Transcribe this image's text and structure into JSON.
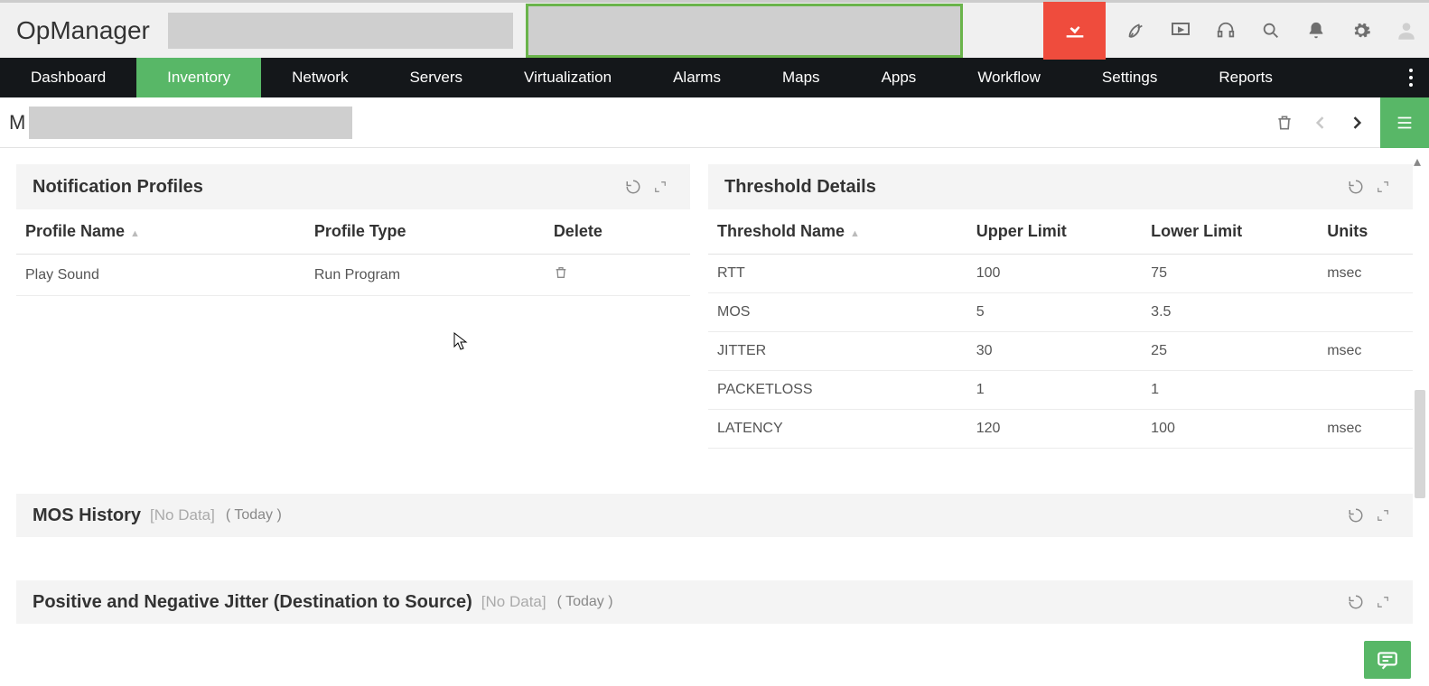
{
  "app_name": "OpManager",
  "nav": {
    "items": [
      "Dashboard",
      "Inventory",
      "Network",
      "Servers",
      "Virtualization",
      "Alarms",
      "Maps",
      "Apps",
      "Workflow",
      "Settings",
      "Reports"
    ],
    "active_index": 1
  },
  "sub_header": {
    "crumb_prefix": "M"
  },
  "notification_profiles": {
    "title": "Notification Profiles",
    "columns": [
      "Profile Name",
      "Profile Type",
      "Delete"
    ],
    "rows": [
      {
        "name": "Play Sound",
        "type": "Run Program"
      }
    ]
  },
  "threshold_details": {
    "title": "Threshold Details",
    "columns": [
      "Threshold Name",
      "Upper Limit",
      "Lower Limit",
      "Units"
    ],
    "rows": [
      {
        "name": "RTT",
        "upper": "100",
        "lower": "75",
        "units": "msec"
      },
      {
        "name": "MOS",
        "upper": "5",
        "lower": "3.5",
        "units": ""
      },
      {
        "name": "JITTER",
        "upper": "30",
        "lower": "25",
        "units": "msec"
      },
      {
        "name": "PACKETLOSS",
        "upper": "1",
        "lower": "1",
        "units": ""
      },
      {
        "name": "LATENCY",
        "upper": "120",
        "lower": "100",
        "units": "msec"
      }
    ]
  },
  "mos_history": {
    "title": "MOS History",
    "nodata": "[No Data]",
    "range": "( Today )"
  },
  "jitter_panel": {
    "title": "Positive and Negative Jitter (Destination to Source)",
    "nodata": "[No Data]",
    "range": "( Today )"
  }
}
